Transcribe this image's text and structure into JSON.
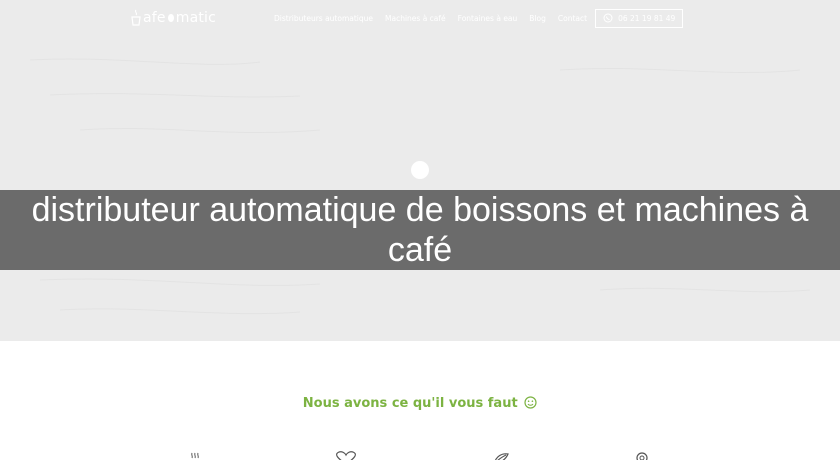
{
  "header": {
    "logo_text": "afe",
    "logo_text2": "matic",
    "nav": [
      {
        "label": "Distributeurs automatique"
      },
      {
        "label": "Machines à café"
      },
      {
        "label": "Fontaines à eau"
      },
      {
        "label": "Blog"
      },
      {
        "label": "Contact"
      }
    ],
    "phone": "06 21 19 81 49"
  },
  "hero": {
    "title": "distributeur automatique de boissons et machines à café"
  },
  "section": {
    "tagline": "Nous avons ce qu'il vous faut"
  },
  "colors": {
    "accent": "#7cb342",
    "band": "#5f5f5f",
    "hero_bg": "#ebebeb"
  },
  "icons": [
    "coffee-cup-icon",
    "heart-icon",
    "leaf-icon",
    "location-icon"
  ]
}
